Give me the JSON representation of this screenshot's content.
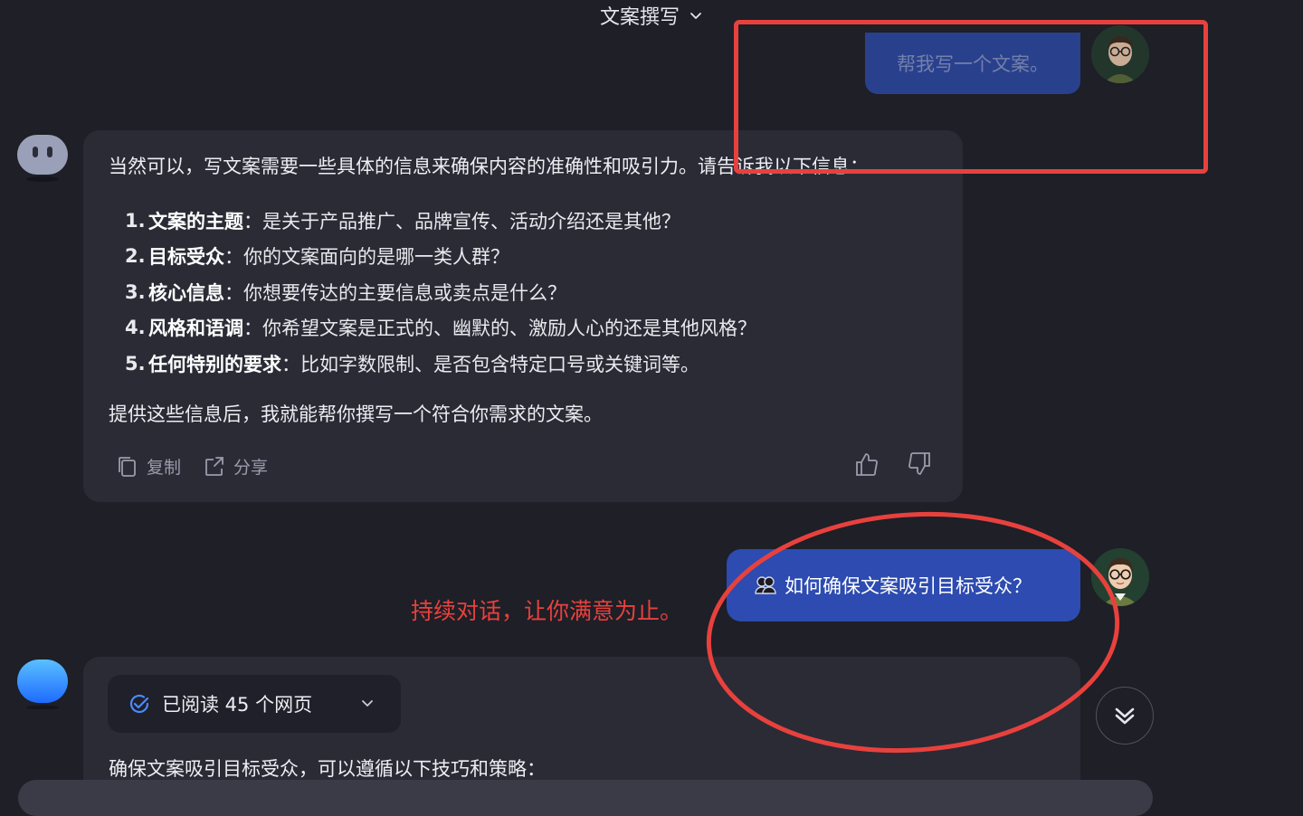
{
  "header": {
    "title": "文案撰写"
  },
  "messages": {
    "user_1": {
      "text": "帮我写一个文案。"
    },
    "bot_1": {
      "intro": "当然可以，写文案需要一些具体的信息来确保内容的准确性和吸引力。请告诉我以下信息：",
      "items": [
        {
          "num": "1.",
          "bold": "文案的主题",
          "rest": "：是关于产品推广、品牌宣传、活动介绍还是其他？"
        },
        {
          "num": "2.",
          "bold": "目标受众",
          "rest": "：你的文案面向的是哪一类人群？"
        },
        {
          "num": "3.",
          "bold": "核心信息",
          "rest": "：你想要传达的主要信息或卖点是什么？"
        },
        {
          "num": "4.",
          "bold": "风格和语调",
          "rest": "：你希望文案是正式的、幽默的、激励人心的还是其他风格？"
        },
        {
          "num": "5.",
          "bold": "任何特别的要求",
          "rest": "：比如字数限制、是否包含特定口号或关键词等。"
        }
      ],
      "closing": "提供这些信息后，我就能帮你撰写一个符合你需求的文案。",
      "actions": {
        "copy": "复制",
        "share": "分享"
      }
    },
    "user_2": {
      "text": "如何确保文案吸引目标受众？"
    },
    "bot_2": {
      "read_pill": "已阅读 45 个网页",
      "text": "确保文案吸引目标受众，可以遵循以下技巧和策略："
    }
  },
  "annotation": {
    "text": "持续对话，让你满意为止。",
    "color": "#e8413d"
  },
  "colors": {
    "background": "#1e1f27",
    "card": "#2a2b35",
    "user_bubble": "#2d4bb0",
    "accent_red": "#e8413d"
  },
  "icons": [
    "chevron-down-icon",
    "copy-icon",
    "share-icon",
    "thumbs-up-icon",
    "thumbs-down-icon",
    "check-circle-icon",
    "double-chevron-down-icon",
    "bot-avatar-icon",
    "user-avatar-icon",
    "people-icon"
  ]
}
